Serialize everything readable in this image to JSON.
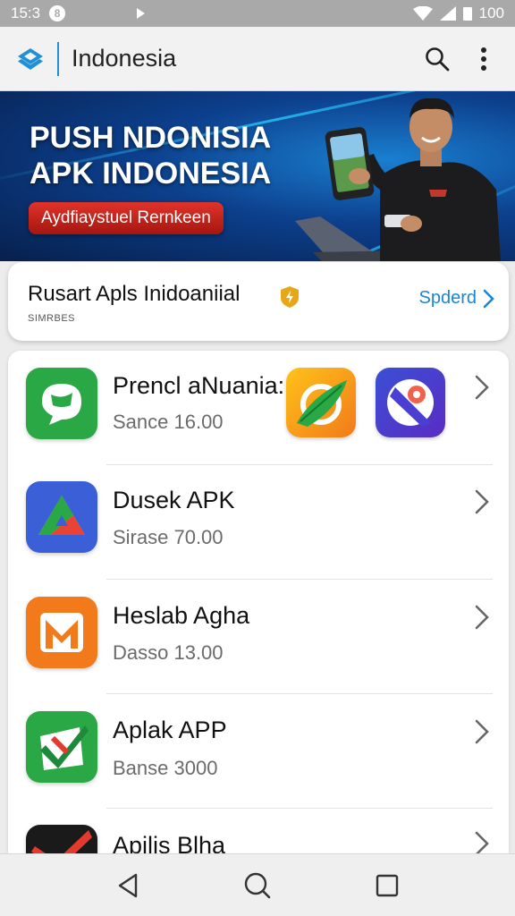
{
  "status_bar": {
    "time": "15:3",
    "notif_glyph": "8",
    "battery": "100",
    "icons": [
      "notification-icon",
      "play-icon",
      "wifi-icon",
      "signal-icon",
      "battery-icon"
    ]
  },
  "app_bar": {
    "title": "Indonesia",
    "logo": "app-logo-icon",
    "actions": [
      "search-icon",
      "more-vert-icon"
    ]
  },
  "banner": {
    "title_line1": "PUSH NDONISIA",
    "title_line2": "APK INDONESIA",
    "button_label": "Aydfiaystuel Rernkeen"
  },
  "featured": {
    "title": "Rusart Apls Inidoaniial",
    "subtitle": "SIMRBES",
    "link_label": "Spderd"
  },
  "apps": [
    {
      "name": "Prencl aNuania:",
      "meta": "Sance 16.00",
      "icon": "chat-bubble-icon",
      "color": "#2aa845"
    },
    {
      "name": "Dusek APK",
      "meta": "Sirase 70.00",
      "icon": "drive-triangle-icon",
      "color": "#3b5fd6"
    },
    {
      "name": "Heslab Agha",
      "meta": "Dasso 13.00",
      "icon": "m-letter-icon",
      "color": "#f27a1a"
    },
    {
      "name": "Aplak APP",
      "meta": "Banse 3000",
      "icon": "check-mark-icon",
      "color": "#2aa845"
    },
    {
      "name": "Apilis Blha",
      "meta": "",
      "icon": "red-check-icon",
      "color": "#1a1a1a"
    }
  ],
  "nav_bar": [
    "back-icon",
    "home-icon",
    "recents-icon"
  ],
  "colors": {
    "accent": "#1a86d6",
    "banner_button": "#c9221b",
    "status_bar": "#a9a9a9"
  }
}
